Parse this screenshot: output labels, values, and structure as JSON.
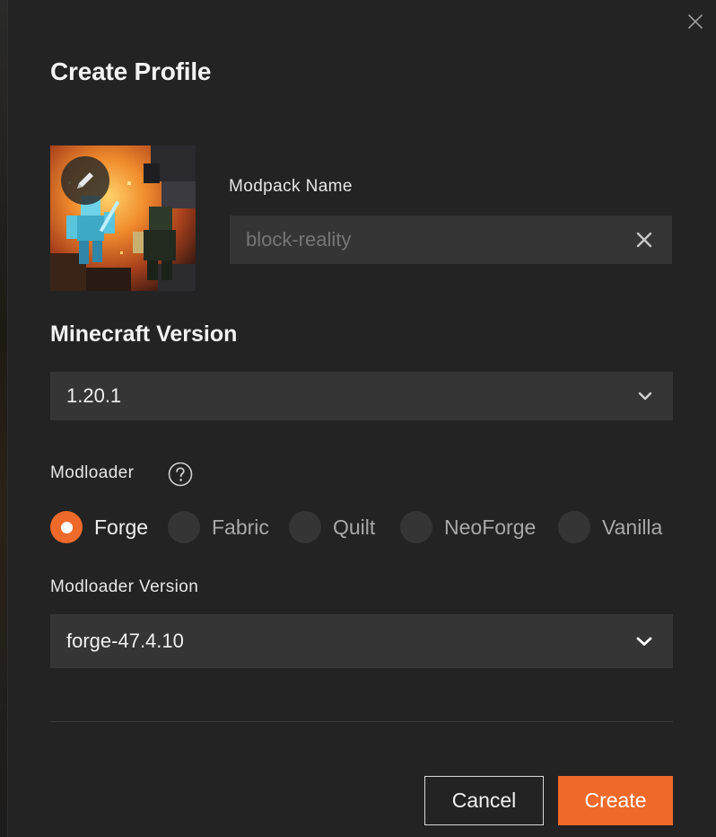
{
  "dialog": {
    "title": "Create Profile"
  },
  "modpack_name": {
    "label": "Modpack Name",
    "value": "",
    "placeholder": "block-reality"
  },
  "minecraft_version": {
    "label": "Minecraft Version",
    "selected": "1.20.1"
  },
  "modloader": {
    "label": "Modloader",
    "options": [
      {
        "label": "Forge",
        "selected": true
      },
      {
        "label": "Fabric",
        "selected": false
      },
      {
        "label": "Quilt",
        "selected": false
      },
      {
        "label": "NeoForge",
        "selected": false
      },
      {
        "label": "Vanilla",
        "selected": false
      }
    ]
  },
  "modloader_version": {
    "label": "Modloader Version",
    "selected": "forge-47.4.10"
  },
  "actions": {
    "cancel_label": "Cancel",
    "create_label": "Create"
  },
  "colors": {
    "accent": "#ee6a2a",
    "dialog_bg": "#232323",
    "field_bg": "#353535"
  },
  "icons": {
    "close": "close-icon",
    "edit": "pencil-icon",
    "clear": "clear-icon",
    "dropdown": "chevron-down-icon",
    "help": "help-icon"
  }
}
